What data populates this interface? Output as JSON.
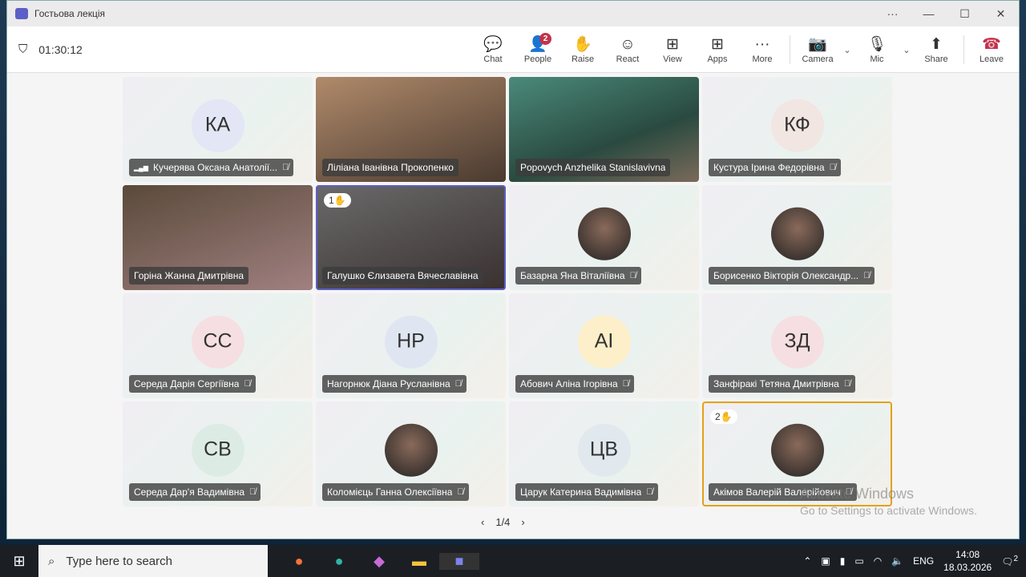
{
  "window": {
    "title": "Гостьова лекція",
    "controls": [
      "···",
      "—",
      "☐",
      "✕"
    ]
  },
  "toolbar": {
    "timer": "01:30:12",
    "people_badge": "2",
    "buttons": [
      {
        "label": "Chat",
        "icon": "chat-icon",
        "glyph": "💬"
      },
      {
        "label": "People",
        "icon": "people-icon",
        "glyph": "👤"
      },
      {
        "label": "Raise",
        "icon": "raise-hand-icon",
        "glyph": "✋"
      },
      {
        "label": "React",
        "icon": "smile-icon",
        "glyph": "☺"
      },
      {
        "label": "View",
        "icon": "grid-icon",
        "glyph": "⊞"
      },
      {
        "label": "Apps",
        "icon": "plus-box-icon",
        "glyph": "⊞"
      },
      {
        "label": "More",
        "icon": "more-icon",
        "glyph": "···"
      },
      {
        "label": "Camera",
        "icon": "camera-off-icon",
        "glyph": "📷"
      },
      {
        "label": "Mic",
        "icon": "mic-off-icon",
        "glyph": "🎙"
      },
      {
        "label": "Share",
        "icon": "share-icon",
        "glyph": "⬆"
      },
      {
        "label": "Leave",
        "icon": "hang-up-icon",
        "glyph": "☎"
      }
    ]
  },
  "participants": [
    {
      "name": "Кучерява Оксана Анатолії...",
      "initials": "КА",
      "type": "avatar",
      "color": "#e3e6f4",
      "muted": true,
      "signal": true
    },
    {
      "name": "Ліліана Іванівна Прокопенко",
      "type": "video",
      "muted": false
    },
    {
      "name": "Popovych Anzhelika Stanislavivna",
      "type": "video",
      "muted": false
    },
    {
      "name": "Кустура Ірина Федорівна",
      "initials": "КФ",
      "type": "avatar",
      "color": "#f1e6e2",
      "muted": true
    },
    {
      "name": "Горіна Жанна Дмитрівна",
      "type": "video",
      "muted": false
    },
    {
      "name": "Галушко Єлизавета Вячеславівна",
      "type": "video",
      "muted": false,
      "hand": "1",
      "highlight": "#5b5fc7"
    },
    {
      "name": "Базарна Яна Віталіївна",
      "type": "photo",
      "muted": true
    },
    {
      "name": "Борисенко Вікторія Олександр...",
      "type": "photo",
      "muted": true
    },
    {
      "name": "Середа Дарія Сергіївна",
      "initials": "СС",
      "type": "avatar",
      "color": "#f6dfe2",
      "muted": true
    },
    {
      "name": "Нагорнюк Діана Русланівна",
      "initials": "НР",
      "type": "avatar",
      "color": "#dfe6f1",
      "muted": true
    },
    {
      "name": "Абович Аліна Ігорівна",
      "initials": "АІ",
      "type": "avatar",
      "color": "#fcefc9",
      "muted": true
    },
    {
      "name": "Занфіракі Тетяна Дмитрівна",
      "initials": "ЗД",
      "type": "avatar",
      "color": "#f6dfe2",
      "muted": true
    },
    {
      "name": "Середа Дар'я Вадимівна",
      "initials": "СВ",
      "type": "avatar",
      "color": "#dcece5",
      "muted": true
    },
    {
      "name": "Коломієць Ганна Олексіївна",
      "type": "photo",
      "muted": true
    },
    {
      "name": "Царук Катерина Вадимівна",
      "initials": "ЦВ",
      "type": "avatar",
      "color": "#e1e9ef",
      "muted": true
    },
    {
      "name": "Акімов Валерій Валерійович",
      "type": "photo",
      "muted": true,
      "hand": "2",
      "highlight": "#e3a21a"
    }
  ],
  "pager": {
    "prev": "‹",
    "label": "1/4",
    "next": "›"
  },
  "watermark": {
    "line1": "Activate Windows",
    "line2": "Go to Settings to activate Windows."
  },
  "taskbar": {
    "search_placeholder": "Type here to search",
    "tray_lang": "ENG",
    "time": "14:08",
    "date": "18.03.2026",
    "notif_count": "2"
  }
}
